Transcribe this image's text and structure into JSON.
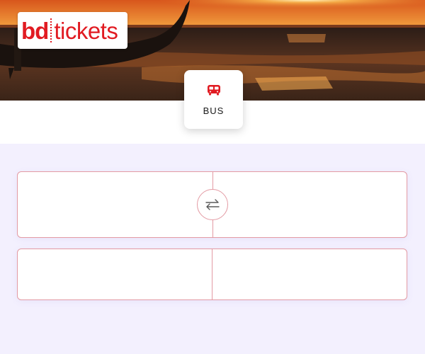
{
  "brand": {
    "logo_left": "bd",
    "logo_right": "tickets",
    "color": "#e11b22"
  },
  "mode": {
    "label": "BUS",
    "icon": "bus-icon"
  },
  "search": {
    "from_value": "",
    "to_value": "",
    "swap_icon": "swap-arrows-icon",
    "journey_date": "",
    "return_date": "",
    "border_color": "#e39aa3",
    "background": "#f3f0fe"
  }
}
